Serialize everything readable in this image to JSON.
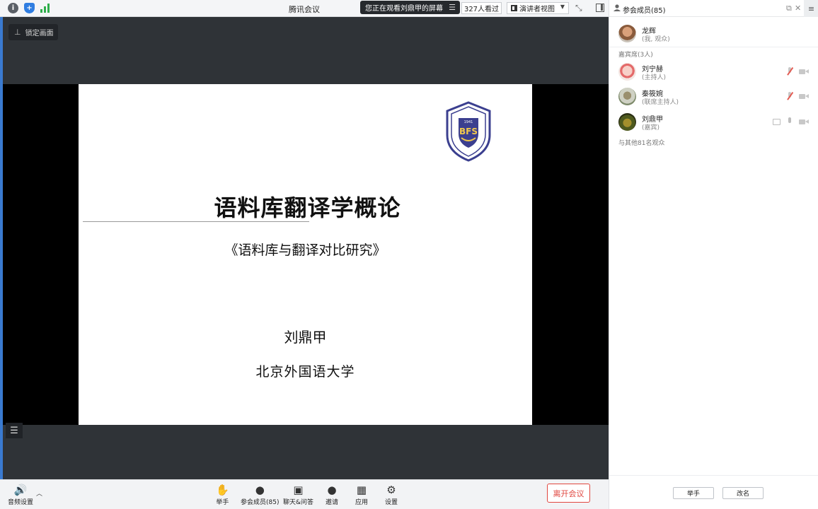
{
  "topbar": {
    "meeting_title": "腾讯会议",
    "watch_notice": "您正在观看刘鼎甲的屏幕",
    "viewers": "327人看过",
    "view_mode": "演讲者视图"
  },
  "lock_button": {
    "label": "锁定画面"
  },
  "slide": {
    "logo_text": "BFS",
    "logo_year": "1941",
    "title": "语料库翻译学概论",
    "subtitle": "《语料库与翻译对比研究》",
    "author": "刘鼎甲",
    "organization": "北京外国语大学"
  },
  "toolbar": {
    "audio_settings": "音频设置",
    "raise_hand": "举手",
    "members": "参会成员(85)",
    "chat_qa": "聊天&问答",
    "invite": "邀请",
    "apps": "应用",
    "settings": "设置",
    "leave": "离开会议"
  },
  "panel": {
    "title": "参会成员(85)",
    "self": {
      "name": "龙辉",
      "role": "(我, 观众)"
    },
    "guest_section": "嘉宾席(3人)",
    "guests": [
      {
        "name": "刘宁赫",
        "role": "(主持人)"
      },
      {
        "name": "秦筱婉",
        "role": "(联席主持人)"
      },
      {
        "name": "刘鼎甲",
        "role": "(嘉宾)"
      }
    ],
    "audience_note": "与其他81名观众",
    "raise_hand_button": "举手",
    "rename_button": "改名"
  },
  "colors": {
    "accent_blue": "#2f7de1",
    "leave_red": "#e0463f",
    "meeting_bg": "#2f3337",
    "signal_green": "#2eae4a"
  }
}
